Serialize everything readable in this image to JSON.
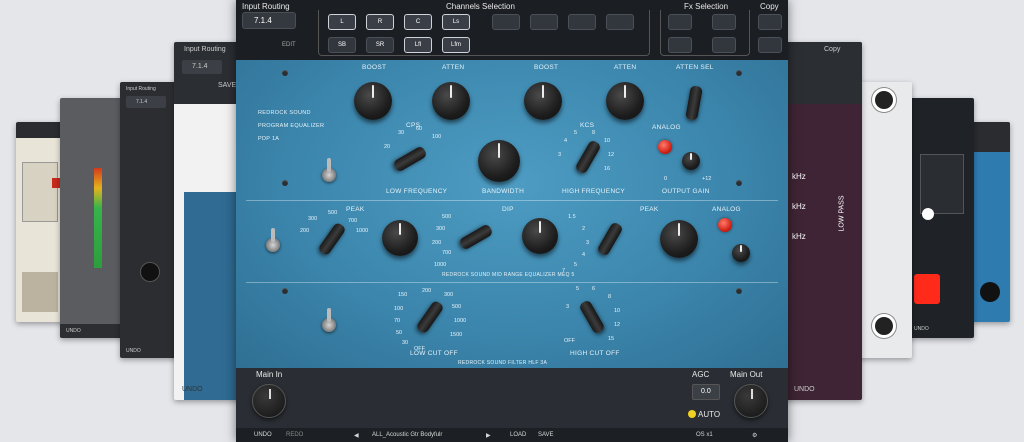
{
  "header": {
    "input_routing_label": "Input Routing",
    "input_routing_value": "7.1.4",
    "edit_label": "EDIT",
    "channels_label": "Channels Selection",
    "channel_buttons_row1": [
      "L",
      "R",
      "C",
      "Ls",
      "",
      "",
      "",
      ""
    ],
    "channel_buttons_row2": [
      "SB",
      "SR",
      "Lfl",
      "Lfm"
    ],
    "fx_label": "Fx Selection",
    "copy_label": "Copy"
  },
  "faceplate": {
    "brand_lines": [
      "REDROCK SOUND",
      "PROGRAM EQUALIZER",
      "PDP 1A"
    ],
    "boost_label": "BOOST",
    "atten_label": "ATTEN",
    "atten_sel_label": "ATTEN SEL",
    "cps_label": "CPS",
    "kcs_label": "KCS",
    "analog_label": "ANALOG",
    "low_freq_label": "LOW FREQUENCY",
    "bandwidth_label": "BANDWIDTH",
    "high_freq_label": "HIGH FREQUENCY",
    "output_gain_label": "OUTPUT GAIN",
    "peak_label": "PEAK",
    "dip_label": "DIP",
    "mid_label": "REDROCK SOUND  MID RANGE EQUALIZER  MEQ 5",
    "low_cut_label": "LOW CUT OFF",
    "high_cut_label": "HIGH CUT OFF",
    "bottom_brand": "REDROCK SOUND  FILTER  HLF 3A",
    "low_freq_scale": [
      "20",
      "30",
      "60",
      "100"
    ],
    "high_freq_scale": [
      "3",
      "4",
      "5",
      "8",
      "10",
      "12",
      "16"
    ],
    "peak_scale": [
      "300",
      "200",
      "500",
      "700",
      "1000"
    ],
    "dip_scale": [
      "200",
      "300",
      "500",
      "700",
      "1000",
      "1.5",
      "2",
      "3",
      "4",
      "5",
      "7"
    ],
    "low_cut_scale": [
      "150",
      "200",
      "300",
      "500",
      "1000",
      "1500",
      "100",
      "70",
      "50",
      "30",
      "OFF"
    ],
    "high_cut_scale": [
      "5",
      "6",
      "8",
      "10",
      "12",
      "15",
      "3",
      "OFF"
    ],
    "output_scale": [
      "0",
      "+12"
    ]
  },
  "footer": {
    "main_in_label": "Main In",
    "agc_label": "AGC",
    "main_out_label": "Main Out",
    "agc_value": "0.0",
    "auto_label": "AUTO",
    "undo_label": "UNDO",
    "redo_label": "REDO",
    "preset_name": "ALL_Acoustic Gtr Bodyfulr",
    "load_label": "LOAD",
    "save_label": "SAVE",
    "os_label": "OS x1"
  },
  "bg_plugins": {
    "left1_label": "Input Routing",
    "left1_value": "7.1.4",
    "left1_save": "SAVE",
    "left2_label": "Input Routing",
    "left2_value": "7.1.4",
    "right1_copy": "Copy",
    "right1_freq": [
      "kHz",
      "kHz",
      "kHz"
    ],
    "right1_lowpass": "LOW PASS",
    "undo_labels": [
      "UNDO",
      "UNDO",
      "UNDO",
      "UNDO",
      "UNDO"
    ]
  }
}
